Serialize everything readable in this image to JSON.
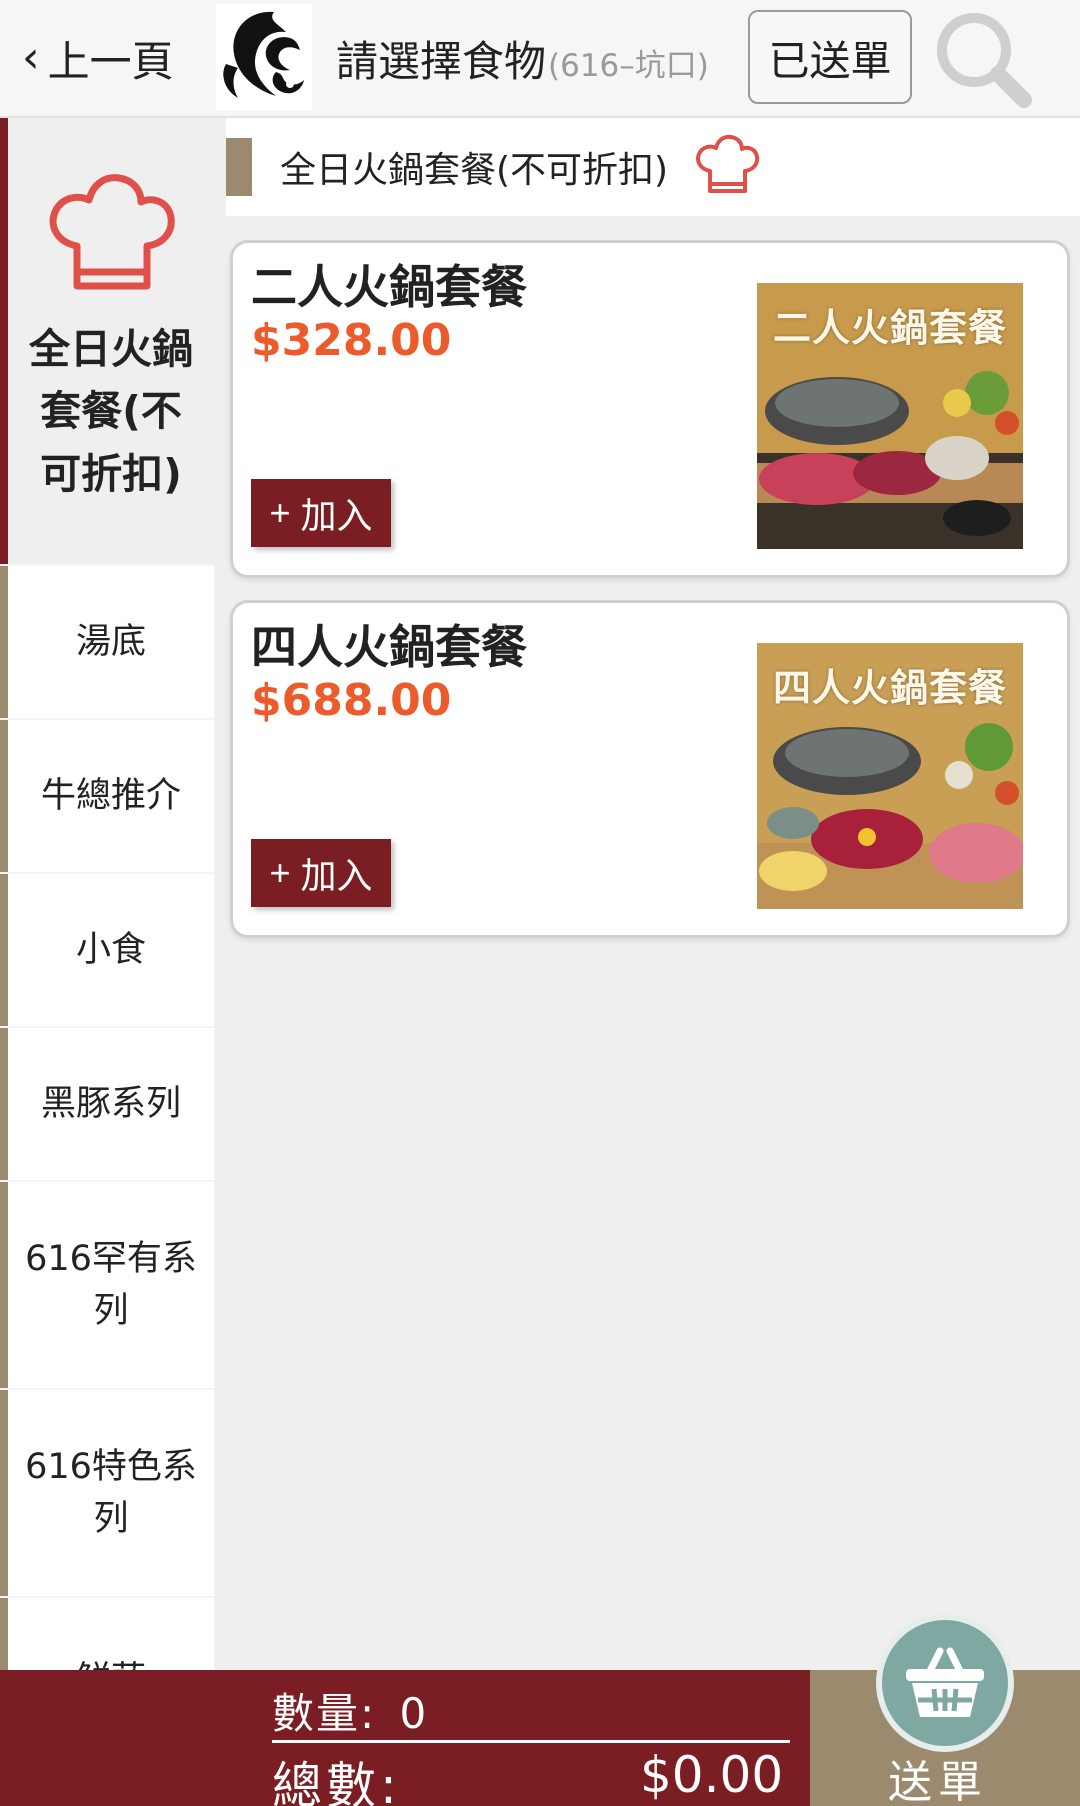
{
  "header": {
    "back_label": "上一頁",
    "title": "請選擇食物",
    "store": "(616–坑口)",
    "sent_orders_label": "已送單"
  },
  "sidebar": {
    "items": [
      {
        "label": "全日火鍋套餐(不可折扣)",
        "active": true
      },
      {
        "label": "湯底"
      },
      {
        "label": "牛總推介"
      },
      {
        "label": "小食"
      },
      {
        "label": "黑豚系列"
      },
      {
        "label": "616罕有系列"
      },
      {
        "label": "616特色系列"
      },
      {
        "label": "鮮蔬"
      }
    ]
  },
  "section": {
    "title": "全日火鍋套餐(不可折扣)"
  },
  "products": [
    {
      "name": "二人火鍋套餐",
      "price": "$328.00",
      "add_label": "加入",
      "image_caption": "二人火鍋套餐"
    },
    {
      "name": "四人火鍋套餐",
      "price": "$688.00",
      "add_label": "加入",
      "image_caption": "四人火鍋套餐"
    }
  ],
  "footer": {
    "quantity_label": "數量:",
    "quantity_value": "0",
    "total_label": "總數:",
    "total_value": "$0.00",
    "submit_label": "送單"
  },
  "colors": {
    "primary": "#7b1e24",
    "accent_tan": "#9b8a6e",
    "price": "#ec5b2b",
    "chef_icon": "#e0504a",
    "basket": "#7fa8a3"
  },
  "icons": [
    "back-chevron-icon",
    "logo",
    "search-icon",
    "chef-hat-icon",
    "plus-icon",
    "basket-icon"
  ]
}
